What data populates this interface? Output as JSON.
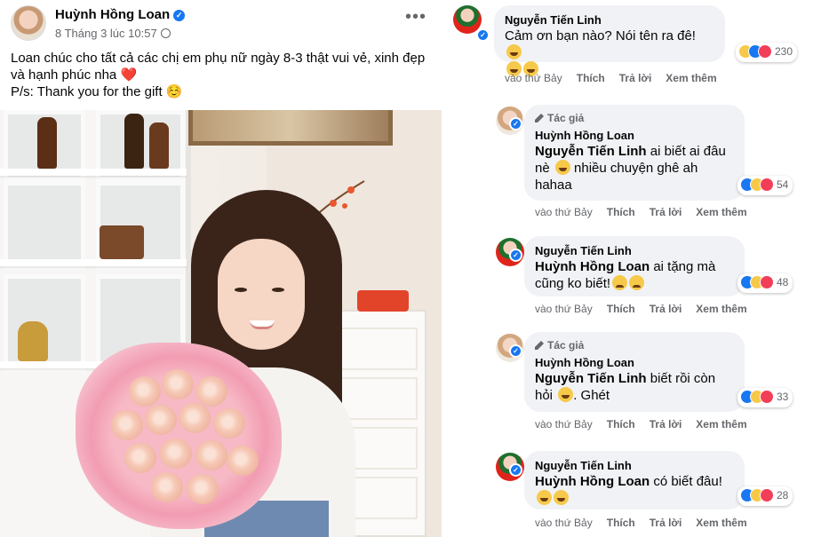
{
  "post": {
    "author": "Huỳnh Hồng Loan",
    "timestamp": "8 Tháng 3 lúc 10:57",
    "text_line1": "Loan chúc cho tất cả các chị em phụ nữ ngày 8-3 thật vui vẻ, xinh đẹp",
    "text_line2": "và hạnh phúc nha",
    "text_line3": "P/s: Thank you for the gift",
    "heart_emoji": "❤️",
    "smile_emoji": "☺️"
  },
  "comments": [
    {
      "author": "Nguyễn Tiến Linh",
      "text": "Cảm ơn bạn nào? Nói tên ra đê!",
      "reaction_count": "230",
      "time": "vào thứ Bảy",
      "like_label": "Thích",
      "reply_label": "Trả lời",
      "more_label": "Xem thêm"
    },
    {
      "author_tag": "Tác giả",
      "author": "Huỳnh Hồng Loan",
      "mention": "Nguyễn Tiến Linh",
      "text": "ai biết ai đâu",
      "text2_a": "nè",
      "text2_b": "nhiều chuyện ghê ah",
      "text3": "hahaa",
      "reaction_count": "54",
      "time": "vào thứ Bảy",
      "like_label": "Thích",
      "reply_label": "Trả lời",
      "more_label": "Xem thêm"
    },
    {
      "author": "Nguyễn Tiến Linh",
      "mention": "Huỳnh Hồng Loan",
      "text": "ai tặng mà",
      "text2": "cũng ko biết!",
      "reaction_count": "48",
      "time": "vào thứ Bảy",
      "like_label": "Thích",
      "reply_label": "Trả lời",
      "more_label": "Xem thêm"
    },
    {
      "author_tag": "Tác giả",
      "author": "Huỳnh Hồng Loan",
      "mention": "Nguyễn Tiến Linh",
      "text": "biết rồi còn",
      "text2_a": "hỏi",
      "text2_b": ". Ghét",
      "reaction_count": "33",
      "time": "vào thứ Bảy",
      "like_label": "Thích",
      "reply_label": "Trả lời",
      "more_label": "Xem thêm"
    },
    {
      "author": "Nguyễn Tiến Linh",
      "mention": "Huỳnh Hồng Loan",
      "text": "có biết đâu!",
      "reaction_count": "28",
      "time": "vào thứ Bảy",
      "like_label": "Thích",
      "reply_label": "Trả lời",
      "more_label": "Xem thêm"
    }
  ],
  "colors": {
    "bubble": "#f0f2f5",
    "secondary_text": "#65676b",
    "verified_blue": "#1877f2"
  },
  "icons": [
    "verified-icon",
    "globe-icon",
    "more-options-icon",
    "author-badge-icon",
    "haha-reaction-icon",
    "like-reaction-icon",
    "love-reaction-icon"
  ]
}
